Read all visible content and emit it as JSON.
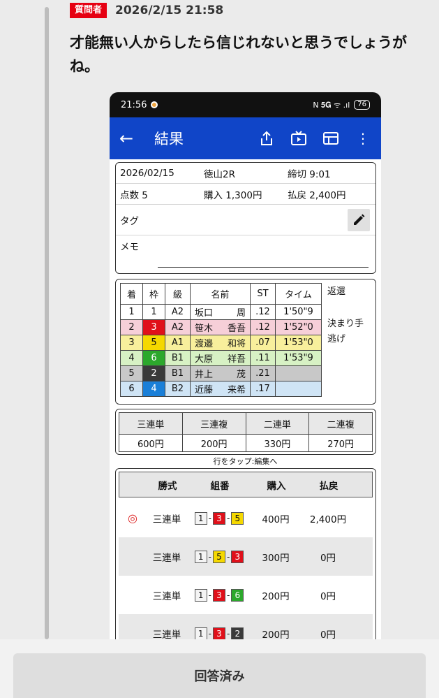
{
  "post": {
    "badge": "質問者",
    "time": "2026/2/15 21:58",
    "text": "才能無い人からしたら信じれないと思うでしょうがね。"
  },
  "phone": {
    "status_time": "21:56",
    "battery": "76",
    "status_icons": "N 𝟓𝐆 ᯤ .ıl",
    "appbar_title": "結果",
    "info": {
      "date": "2026/02/15",
      "race": "徳山2R",
      "deadline": "締切 9:01",
      "points": "点数 5",
      "purchase": "購入 1,300円",
      "payout": "払戻 2,400円",
      "tag_label": "タグ",
      "memo_label": "メモ"
    },
    "race_table": {
      "headers": [
        "着",
        "枠",
        "級",
        "名前",
        "ST",
        "タイム"
      ],
      "rows": [
        {
          "rank": "1",
          "frame": "1",
          "class": "A2",
          "name_last": "坂口",
          "name_first": "周",
          "st": ".12",
          "time": "1'50\"9"
        },
        {
          "rank": "2",
          "frame": "3",
          "class": "A2",
          "name_last": "笹木",
          "name_first": "香吾",
          "st": ".12",
          "time": "1'52\"0"
        },
        {
          "rank": "3",
          "frame": "5",
          "class": "A1",
          "name_last": "渡邉",
          "name_first": "和将",
          "st": ".07",
          "time": "1'53\"0"
        },
        {
          "rank": "4",
          "frame": "6",
          "class": "B1",
          "name_last": "大原",
          "name_first": "祥吾",
          "st": ".11",
          "time": "1'53\"9"
        },
        {
          "rank": "5",
          "frame": "2",
          "class": "B1",
          "name_last": "井上",
          "name_first": "茂",
          "st": ".21",
          "time": ""
        },
        {
          "rank": "6",
          "frame": "4",
          "class": "B2",
          "name_last": "近藤",
          "name_first": "来希",
          "st": ".17",
          "time": ""
        }
      ],
      "refund_label": "返還",
      "kimarite_label": "決まり手",
      "kimarite_value": "逃げ"
    },
    "payouts": {
      "types": [
        "三連単",
        "三連複",
        "二連単",
        "二連複"
      ],
      "amounts": [
        "600円",
        "200円",
        "330円",
        "270円"
      ]
    },
    "tap_note": "行をタップ:編集へ",
    "bets": {
      "headers": [
        "勝式",
        "組番",
        "購入",
        "払戻"
      ],
      "rows": [
        {
          "hit": true,
          "type": "三連単",
          "combo": [
            "1",
            "3",
            "5"
          ],
          "buy": "400円",
          "ret": "2,400円"
        },
        {
          "hit": false,
          "type": "三連単",
          "combo": [
            "1",
            "5",
            "3"
          ],
          "buy": "300円",
          "ret": "0円"
        },
        {
          "hit": false,
          "type": "三連単",
          "combo": [
            "1",
            "3",
            "6"
          ],
          "buy": "200円",
          "ret": "0円"
        },
        {
          "hit": false,
          "type": "三連単",
          "combo": [
            "1",
            "3",
            "2"
          ],
          "buy": "200円",
          "ret": "0円"
        }
      ]
    }
  },
  "frame_colors": {
    "1": "#ffffff",
    "2": "#3a3a3a",
    "3": "#e0101a",
    "4": "#1a7fd8",
    "5": "#f5d800",
    "6": "#2ca82c"
  },
  "answered_button": "回答済み"
}
